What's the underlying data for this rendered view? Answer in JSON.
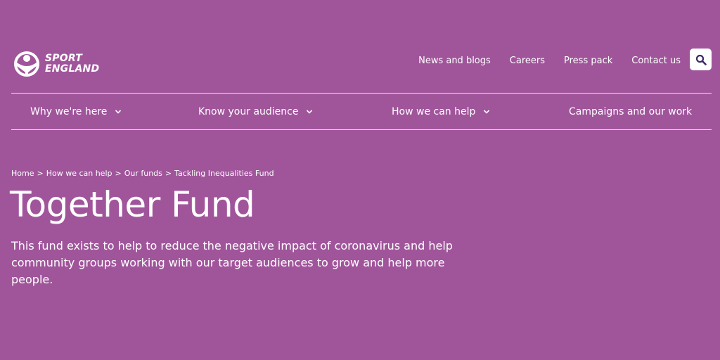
{
  "brand": {
    "line1": "SPORT",
    "line2": "ENGLAND"
  },
  "utility_nav": [
    {
      "label": "News and blogs"
    },
    {
      "label": "Careers"
    },
    {
      "label": "Press pack"
    },
    {
      "label": "Contact us"
    }
  ],
  "search": {
    "icon": "search-icon"
  },
  "main_nav": [
    {
      "label": "Why we're here",
      "has_dropdown": true
    },
    {
      "label": "Know your audience",
      "has_dropdown": true
    },
    {
      "label": "How we can help",
      "has_dropdown": true
    },
    {
      "label": "Campaigns and our work",
      "has_dropdown": false
    }
  ],
  "breadcrumb": [
    {
      "label": "Home"
    },
    {
      "label": "How we can help"
    },
    {
      "label": "Our funds"
    },
    {
      "label": "Tackling Inequalities Fund"
    }
  ],
  "breadcrumb_separator": ">",
  "page": {
    "title": "Together Fund",
    "intro": "This fund exists to help to reduce the negative impact of coronavirus and help community groups working with our target audiences to grow and help more people."
  },
  "colors": {
    "background": "#a0559b",
    "text": "#ffffff",
    "search_icon": "#3b2a6b"
  }
}
